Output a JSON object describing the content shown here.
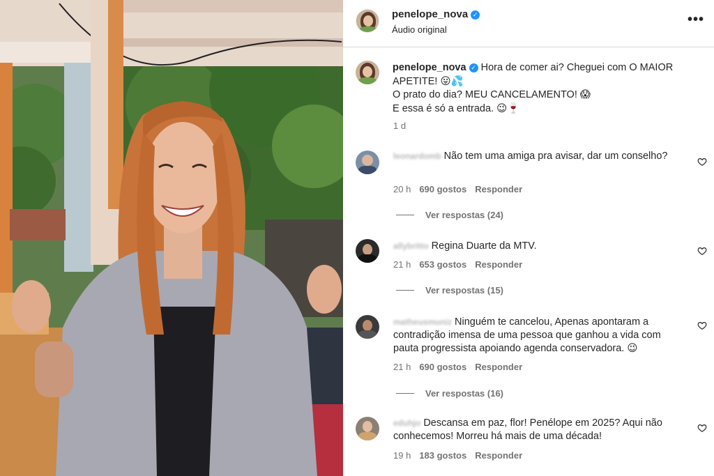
{
  "post": {
    "username": "penelope_nova",
    "audio_label": "Áudio original",
    "caption": {
      "username": "penelope_nova",
      "line1": "Hora de comer ai? Cheguei com O MAIOR APETITE! 😛💦",
      "line2": "O prato do dia? MEU CANCELAMENTO! 😱",
      "line3": "E essa é só a entrada. 😉🍷",
      "age": "1 d"
    }
  },
  "comments": [
    {
      "user": "leonardomb",
      "text": "Não tem uma amiga pra avisar, dar um conselho?",
      "time": "20 h",
      "likes": "690 gostos",
      "reply": "Responder",
      "replies": "Ver respostas (24)"
    },
    {
      "user": "allybritto",
      "text": "Regina Duarte da MTV.",
      "time": "21 h",
      "likes": "653 gostos",
      "reply": "Responder",
      "replies": "Ver respostas (15)"
    },
    {
      "user": "matheusmuniz",
      "text": "Ninguém te cancelou, Apenas apontaram a contradição imensa de uma pessoa que ganhou a vida com pauta progressista apoiando agenda conservadora. 😉",
      "time": "21 h",
      "likes": "690 gostos",
      "reply": "Responder",
      "replies": "Ver respostas (16)"
    },
    {
      "user": "eduhjo",
      "text": "Descansa em paz, flor! Penélope em 2025? Aqui não conhecemos! Morreu há mais de uma década!",
      "time": "19 h",
      "likes": "183 gostos",
      "reply": "Responder"
    }
  ],
  "icons": {
    "verified": "verified-badge-icon",
    "more": "more-options-icon",
    "like": "heart-icon"
  },
  "colors": {
    "verified": "#1f93ff",
    "secondary_text": "#737373",
    "text": "#262626"
  }
}
